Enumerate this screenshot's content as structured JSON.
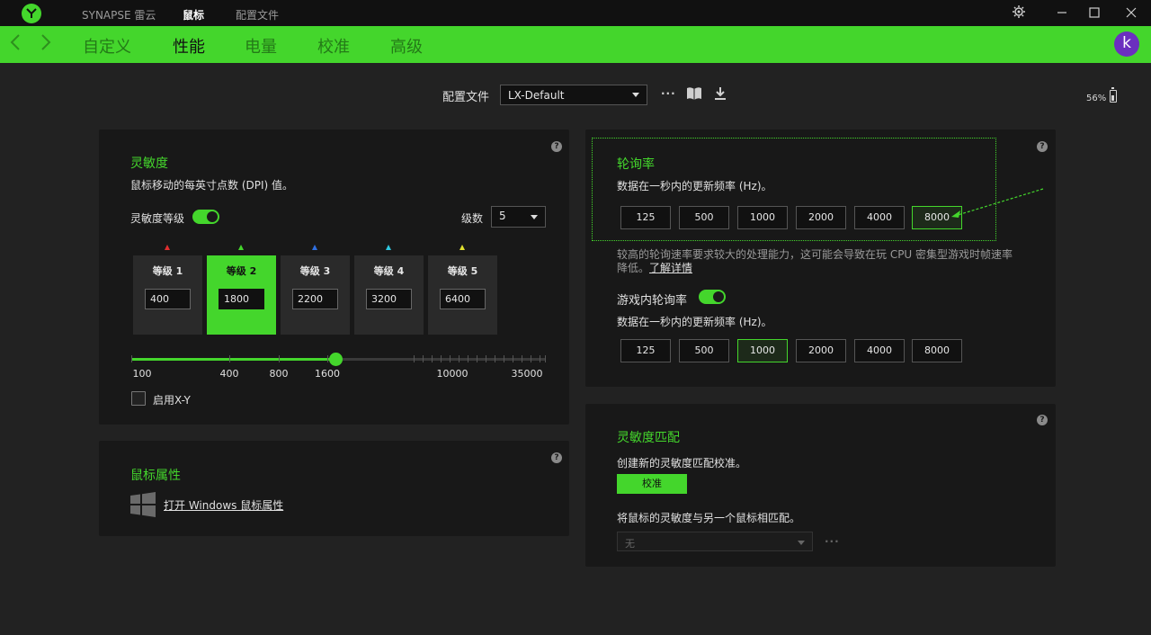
{
  "titlebar": {
    "tabs": [
      {
        "label": "SYNAPSE 雷云",
        "active": false
      },
      {
        "label": "鼠标",
        "active": true
      },
      {
        "label": "配置文件",
        "active": false
      }
    ]
  },
  "nav": {
    "tabs": [
      {
        "label": "自定义",
        "active": false
      },
      {
        "label": "性能",
        "active": true
      },
      {
        "label": "电量",
        "active": false
      },
      {
        "label": "校准",
        "active": false
      },
      {
        "label": "高级",
        "active": false
      }
    ],
    "avatar_letter": "k",
    "accent": "#44d62c",
    "avatar_color": "#6b2fbf"
  },
  "profile": {
    "label": "配置文件",
    "selected": "LX-Default",
    "more": "···",
    "battery": "56%"
  },
  "sensitivity": {
    "title": "灵敏度",
    "desc": "鼠标移动的每英寸点数 (DPI) 值。",
    "stages_toggle_label": "灵敏度等级",
    "stages_toggle_on": true,
    "levels_label": "级数",
    "levels_value": "5",
    "stages": [
      {
        "label": "等级 1",
        "value": "400",
        "color": "#e02f2f",
        "active": false
      },
      {
        "label": "等级 2",
        "value": "1800",
        "color": "#44d62c",
        "active": true
      },
      {
        "label": "等级 3",
        "value": "2200",
        "color": "#2f6fe0",
        "active": false
      },
      {
        "label": "等级 4",
        "value": "3200",
        "color": "#2fc8e0",
        "active": false
      },
      {
        "label": "等级 5",
        "value": "6400",
        "color": "#e0e02f",
        "active": false
      }
    ],
    "slider_ticks": [
      "100",
      "400",
      "800",
      "1600",
      "10000",
      "35000"
    ],
    "slider_value": 1800,
    "xy_label": "启用X-Y",
    "xy_enabled": false
  },
  "mouse_props": {
    "title": "鼠标属性",
    "link": "打开 Windows 鼠标属性"
  },
  "polling": {
    "title": "轮询率",
    "desc": "数据在一秒内的更新频率 (Hz)。",
    "rates": [
      "125",
      "500",
      "1000",
      "2000",
      "4000",
      "8000"
    ],
    "selected": "8000",
    "warning_line1": "较高的轮询速率要求较大的处理能力，这可能会导致在玩 CPU 密集型游戏时帧速率",
    "warning_line2": "降低。",
    "learn_more": "了解详情",
    "ingame_label": "游戏内轮询率",
    "ingame_on": true,
    "ingame_desc": "数据在一秒内的更新频率 (Hz)。",
    "ingame_rates": [
      "125",
      "500",
      "1000",
      "2000",
      "4000",
      "8000"
    ],
    "ingame_selected": "1000"
  },
  "sens_match": {
    "title": "灵敏度匹配",
    "desc": "创建新的灵敏度匹配校准。",
    "calibrate": "校准",
    "desc2": "将鼠标的灵敏度与另一个鼠标相匹配。",
    "select_value": "无",
    "more": "···"
  },
  "help": "?"
}
